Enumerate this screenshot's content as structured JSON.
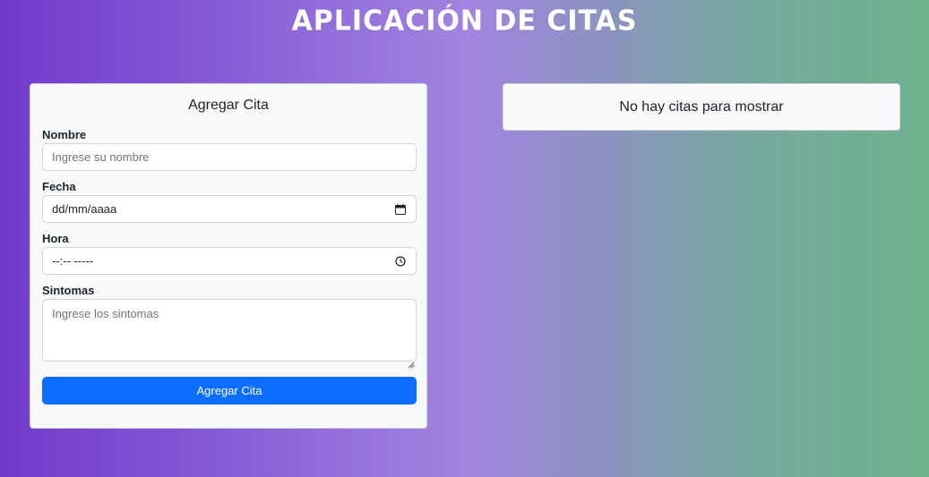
{
  "header": {
    "title": "APLICACIÓN DE CITAS"
  },
  "form": {
    "title": "Agregar Cita",
    "fields": {
      "nombre": {
        "label": "Nombre",
        "placeholder": "Ingrese su nombre",
        "value": ""
      },
      "fecha": {
        "label": "Fecha",
        "value": "dd/mm/aaaa",
        "icon": "calendar-icon"
      },
      "hora": {
        "label": "Hora",
        "value": "--:-- -----",
        "icon": "clock-icon"
      },
      "sintomas": {
        "label": "Sintomas",
        "placeholder": "Ingrese los sintomas",
        "value": ""
      }
    },
    "submit_label": "Agregar Cita"
  },
  "appointments": {
    "empty_message": "No hay citas para mostrar"
  },
  "colors": {
    "primary_button": "#0d6efd",
    "card_background": "#f8f9fa",
    "gradient_start": "#7239cc",
    "gradient_end": "#6cb28c"
  }
}
